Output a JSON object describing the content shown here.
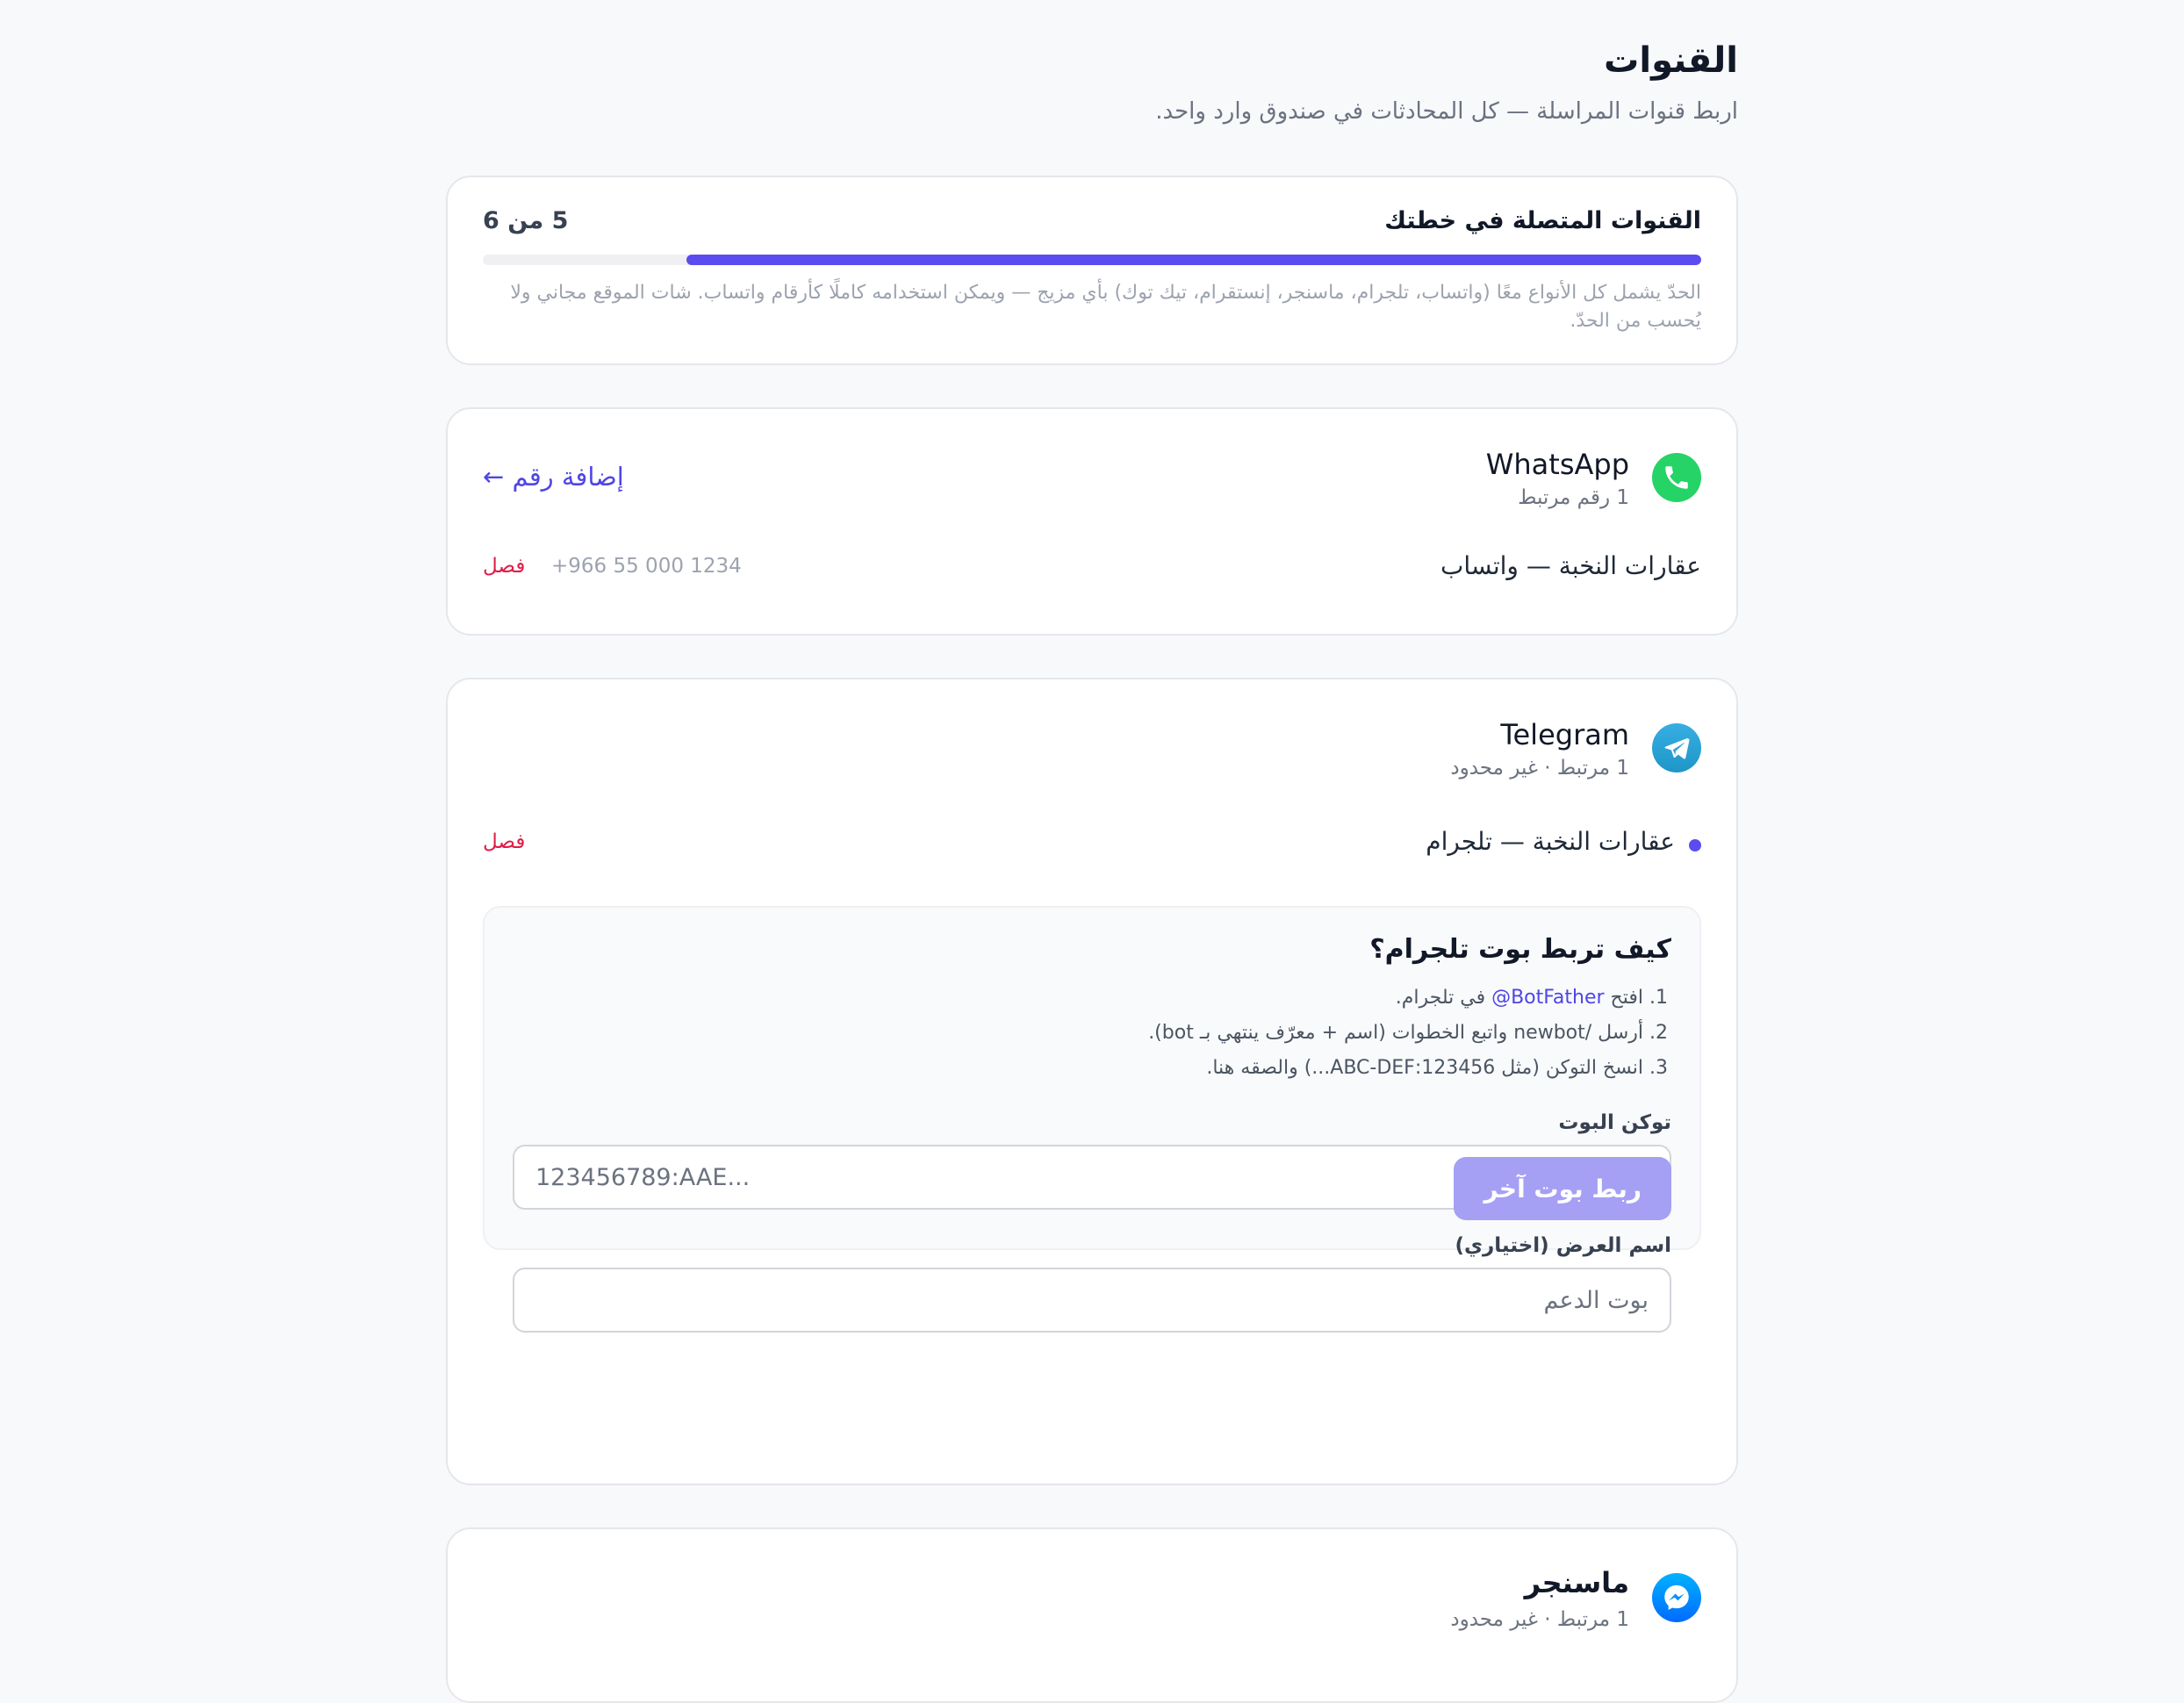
{
  "header": {
    "title": "القنوات",
    "subtitle": "اربط قنوات المراسلة — كل المحادثات في صندوق وارد واحد."
  },
  "plan": {
    "title": "القنوات المتصلة في خطتك",
    "count": "5 من 6",
    "progress": 0.833,
    "note": "الحدّ يشمل كل الأنواع معًا (واتساب، تلجرام، ماسنجر، إنستقرام، تيك توك) بأي مزيج — ويمكن استخدامه كاملًا كأرقام واتساب. شات الموقع مجاني ولا يُحسب من الحدّ."
  },
  "whatsapp": {
    "name": "WhatsApp",
    "sub": "1 رقم مرتبط",
    "add_label": "إضافة رقم ←",
    "icon": "whatsapp-icon",
    "color": "#25d366",
    "numbers": [
      {
        "name": "عقارات النخبة — واتساب",
        "phone": "+966 55 000 1234",
        "disconnect": "فصل"
      }
    ]
  },
  "telegram": {
    "name": "Telegram",
    "sub": "1 مرتبط · غير محدود",
    "icon": "telegram-icon",
    "color": "#2aa3dd",
    "bots": [
      {
        "name": "عقارات النخبة — تلجرام",
        "disconnect": "فصل"
      }
    ],
    "guide": {
      "title": "كيف تربط بوت تلجرام؟",
      "step1_prefix": "1. افتح ",
      "step1_link": "@BotFather",
      "step1_suffix": " في تلجرام.",
      "step2": "2. أرسل /newbot واتبع الخطوات (اسم + معرّف ينتهي بـ bot).",
      "step3": "3. انسخ التوكن (مثل 123456:ABC-DEF...) والصقه هنا."
    },
    "token_label": "توكن البوت",
    "token_placeholder": "123456789:AAE...",
    "display_label": "اسم العرض (اختياري)",
    "display_placeholder": "بوت الدعم",
    "connect_label": "ربط بوت آخر"
  },
  "messenger": {
    "name": "ماسنجر",
    "sub": "1 مرتبط · غير محدود",
    "icon": "messenger-icon",
    "color": "#0a7cff"
  }
}
